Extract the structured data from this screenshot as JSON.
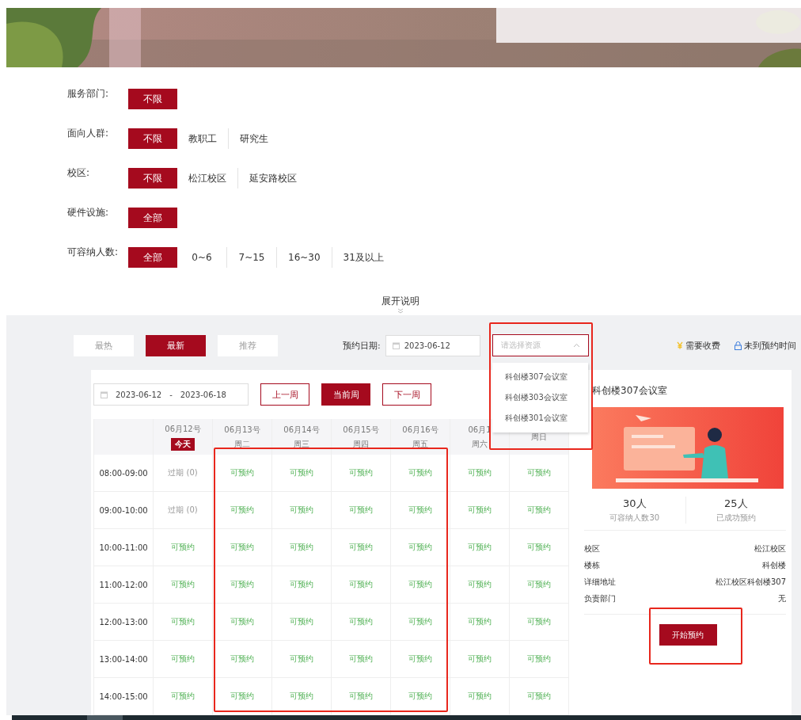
{
  "filters": [
    {
      "label": "服务部门:",
      "options": [
        {
          "text": "不限",
          "selected": true
        }
      ]
    },
    {
      "label": "面向人群:",
      "options": [
        {
          "text": "不限",
          "selected": true
        },
        {
          "text": "教职工",
          "selected": false
        },
        {
          "text": "研究生",
          "selected": false
        }
      ]
    },
    {
      "label": "校区:",
      "options": [
        {
          "text": "不限",
          "selected": true
        },
        {
          "text": "松江校区",
          "selected": false
        },
        {
          "text": "延安路校区",
          "selected": false
        }
      ]
    },
    {
      "label": "硬件设施:",
      "options": [
        {
          "text": "全部",
          "selected": true
        }
      ]
    },
    {
      "label": "可容纳人数:",
      "options": [
        {
          "text": "全部",
          "selected": true
        },
        {
          "text": "0~6",
          "selected": false
        },
        {
          "text": "7~15",
          "selected": false
        },
        {
          "text": "16~30",
          "selected": false
        },
        {
          "text": "31及以上",
          "selected": false
        }
      ]
    }
  ],
  "expand_link": "展开说明",
  "sort_tabs": [
    {
      "label": "最热",
      "selected": false
    },
    {
      "label": "最新",
      "selected": true
    },
    {
      "label": "推荐",
      "selected": false
    }
  ],
  "booking_date": {
    "label": "预约日期:",
    "value": "2023-06-12"
  },
  "resource_select": {
    "placeholder": "请选择资源",
    "expanded": true,
    "options": [
      "科创楼307会议室",
      "科创楼303会议室",
      "科创楼301会议室"
    ]
  },
  "legend": [
    {
      "kind": "fee",
      "label": "需要收费"
    },
    {
      "kind": "locked",
      "label": "未到预约时间"
    }
  ],
  "week_range": {
    "start": "2023-06-12",
    "separator": "-",
    "end": "2023-06-18"
  },
  "week_buttons": [
    {
      "label": "上一周",
      "selected": false
    },
    {
      "label": "当前周",
      "selected": true
    },
    {
      "label": "下一周",
      "selected": false
    }
  ],
  "schedule": {
    "days": [
      {
        "date": "06月12号",
        "day": "今天",
        "today": true
      },
      {
        "date": "06月13号",
        "day": "周二",
        "today": false
      },
      {
        "date": "06月14号",
        "day": "周三",
        "today": false
      },
      {
        "date": "06月15号",
        "day": "周四",
        "today": false
      },
      {
        "date": "06月16号",
        "day": "周五",
        "today": false
      },
      {
        "date": "06月1",
        "day": "周六",
        "today": false
      },
      {
        "day": "周日",
        "today": false
      }
    ],
    "rows": [
      {
        "time": "08:00-09:00",
        "cells": [
          {
            "kind": "past",
            "text": "过期 (0)"
          },
          {
            "kind": "open",
            "text": "可预约"
          },
          {
            "kind": "open",
            "text": "可预约"
          },
          {
            "kind": "open",
            "text": "可预约"
          },
          {
            "kind": "open",
            "text": "可预约"
          },
          {
            "kind": "open",
            "text": "可预约"
          },
          {
            "kind": "open",
            "text": "可预约"
          }
        ]
      },
      {
        "time": "09:00-10:00",
        "cells": [
          {
            "kind": "past",
            "text": "过期 (0)"
          },
          {
            "kind": "open",
            "text": "可预约"
          },
          {
            "kind": "open",
            "text": "可预约"
          },
          {
            "kind": "open",
            "text": "可预约"
          },
          {
            "kind": "open",
            "text": "可预约"
          },
          {
            "kind": "open",
            "text": "可预约"
          },
          {
            "kind": "open",
            "text": "可预约"
          }
        ]
      },
      {
        "time": "10:00-11:00",
        "cells": [
          {
            "kind": "open",
            "text": "可预约"
          },
          {
            "kind": "open",
            "text": "可预约"
          },
          {
            "kind": "open",
            "text": "可预约"
          },
          {
            "kind": "open",
            "text": "可预约"
          },
          {
            "kind": "open",
            "text": "可预约"
          },
          {
            "kind": "open",
            "text": "可预约"
          },
          {
            "kind": "open",
            "text": "可预约"
          }
        ]
      },
      {
        "time": "11:00-12:00",
        "cells": [
          {
            "kind": "open",
            "text": "可预约"
          },
          {
            "kind": "open",
            "text": "可预约"
          },
          {
            "kind": "open",
            "text": "可预约"
          },
          {
            "kind": "open",
            "text": "可预约"
          },
          {
            "kind": "open",
            "text": "可预约"
          },
          {
            "kind": "open",
            "text": "可预约"
          },
          {
            "kind": "open",
            "text": "可预约"
          }
        ]
      },
      {
        "time": "12:00-13:00",
        "cells": [
          {
            "kind": "open",
            "text": "可预约"
          },
          {
            "kind": "open",
            "text": "可预约"
          },
          {
            "kind": "open",
            "text": "可预约"
          },
          {
            "kind": "open",
            "text": "可预约"
          },
          {
            "kind": "open",
            "text": "可预约"
          },
          {
            "kind": "open",
            "text": "可预约"
          },
          {
            "kind": "open",
            "text": "可预约"
          }
        ]
      },
      {
        "time": "13:00-14:00",
        "cells": [
          {
            "kind": "open",
            "text": "可预约"
          },
          {
            "kind": "open",
            "text": "可预约"
          },
          {
            "kind": "open",
            "text": "可预约"
          },
          {
            "kind": "open",
            "text": "可预约"
          },
          {
            "kind": "open",
            "text": "可预约"
          },
          {
            "kind": "open",
            "text": "可预约"
          },
          {
            "kind": "open",
            "text": "可预约"
          }
        ]
      },
      {
        "time": "14:00-15:00",
        "cells": [
          {
            "kind": "open",
            "text": "可预约"
          },
          {
            "kind": "open",
            "text": "可预约"
          },
          {
            "kind": "open",
            "text": "可预约"
          },
          {
            "kind": "open",
            "text": "可预约"
          },
          {
            "kind": "open",
            "text": "可预约"
          },
          {
            "kind": "open",
            "text": "可预约"
          },
          {
            "kind": "open",
            "text": "可预约"
          }
        ]
      }
    ]
  },
  "room": {
    "title": "科创楼307会议室",
    "stats": [
      {
        "value": "30人",
        "label": "可容纳人数30"
      },
      {
        "value": "25人",
        "label": "已成功预约"
      }
    ],
    "info": [
      {
        "label": "校区",
        "value": "松江校区"
      },
      {
        "label": "楼栋",
        "value": "科创楼"
      },
      {
        "label": "详细地址",
        "value": "松江校区科创楼307"
      },
      {
        "label": "负责部门",
        "value": "无"
      }
    ],
    "button": "开始预约"
  }
}
